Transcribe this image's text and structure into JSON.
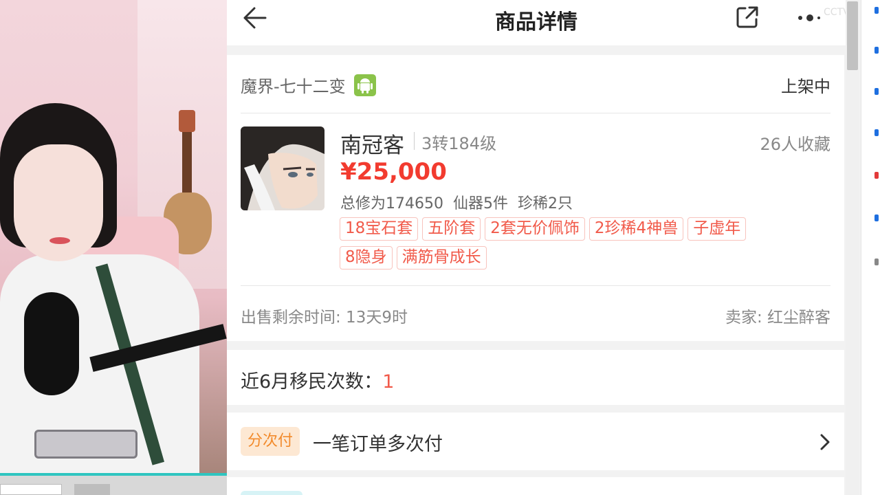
{
  "header": {
    "title": "商品详情",
    "back_icon": "arrow-left-icon",
    "share_icon": "share-icon",
    "more_icon": "more-dots-icon",
    "watermark": "CCTV"
  },
  "item": {
    "server": "魔界-七十二变",
    "platform_icon": "android-icon",
    "status": "上架中",
    "role_name": "南冠客",
    "role_level": "3转184级",
    "favorites": "26人收藏",
    "price": "¥25,000",
    "stats": "总修为174650  仙器5件  珍稀2只",
    "tags": [
      "18宝石套",
      "五阶套",
      "2套无价佩饰",
      "2珍稀4神兽",
      "子虚年",
      "8隐身",
      "满筋骨成长"
    ],
    "sell_time": "出售剩余时间: 13天9时",
    "seller": "卖家: 红尘醉客"
  },
  "migration": {
    "label": "近6月移民次数：",
    "value": "1"
  },
  "payment": {
    "badge": "分次付",
    "text": "一笔订单多次付",
    "arrow_icon": "chevron-right-icon"
  },
  "colors": {
    "price": "#f23b2f",
    "tag_text": "#f15a4a",
    "tag_border": "#f8c3bd",
    "badge_bg": "#fde8d3",
    "badge_text": "#f28a2b",
    "android": "#8bc34a"
  }
}
